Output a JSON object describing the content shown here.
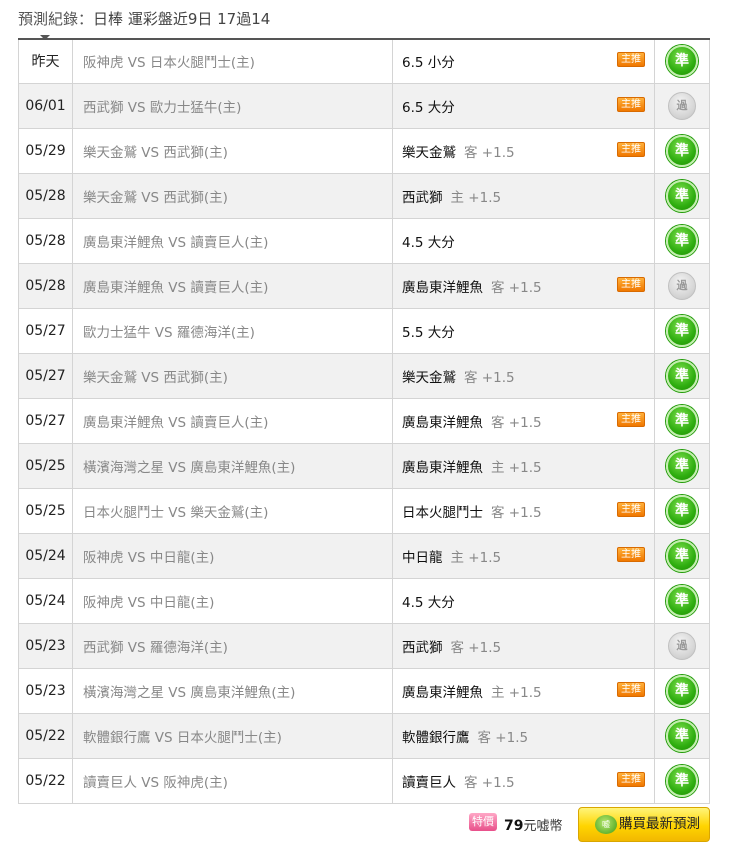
{
  "header": {
    "label": "預測紀錄：",
    "league": "日棒",
    "summary": "運彩盤近9日 17過14"
  },
  "tag_label": "主推",
  "result_labels": {
    "win": "準",
    "pass": "過"
  },
  "rows": [
    {
      "date": "昨天",
      "match": "阪神虎 VS 日本火腿鬥士(主)",
      "pick": "6.5 小分",
      "sub": "",
      "tag": true,
      "result": "win"
    },
    {
      "date": "06/01",
      "match": "西武獅 VS 歐力士猛牛(主)",
      "pick": "6.5 大分",
      "sub": "",
      "tag": true,
      "result": "pass"
    },
    {
      "date": "05/29",
      "match": "樂天金鷲 VS 西武獅(主)",
      "pick": "樂天金鷲",
      "sub": "客 +1.5",
      "tag": true,
      "result": "win"
    },
    {
      "date": "05/28",
      "match": "樂天金鷲 VS 西武獅(主)",
      "pick": "西武獅",
      "sub": "主 +1.5",
      "tag": false,
      "result": "win"
    },
    {
      "date": "05/28",
      "match": "廣島東洋鯉魚 VS 讀賣巨人(主)",
      "pick": "4.5 大分",
      "sub": "",
      "tag": false,
      "result": "win"
    },
    {
      "date": "05/28",
      "match": "廣島東洋鯉魚 VS 讀賣巨人(主)",
      "pick": "廣島東洋鯉魚",
      "sub": "客 +1.5",
      "tag": true,
      "result": "pass"
    },
    {
      "date": "05/27",
      "match": "歐力士猛牛 VS 羅德海洋(主)",
      "pick": "5.5 大分",
      "sub": "",
      "tag": false,
      "result": "win"
    },
    {
      "date": "05/27",
      "match": "樂天金鷲 VS 西武獅(主)",
      "pick": "樂天金鷲",
      "sub": "客 +1.5",
      "tag": false,
      "result": "win"
    },
    {
      "date": "05/27",
      "match": "廣島東洋鯉魚 VS 讀賣巨人(主)",
      "pick": "廣島東洋鯉魚",
      "sub": "客 +1.5",
      "tag": true,
      "result": "win"
    },
    {
      "date": "05/25",
      "match": "橫濱海灣之星 VS 廣島東洋鯉魚(主)",
      "pick": "廣島東洋鯉魚",
      "sub": "主 +1.5",
      "tag": false,
      "result": "win"
    },
    {
      "date": "05/25",
      "match": "日本火腿鬥士 VS 樂天金鷲(主)",
      "pick": "日本火腿鬥士",
      "sub": "客 +1.5",
      "tag": true,
      "result": "win"
    },
    {
      "date": "05/24",
      "match": "阪神虎 VS 中日龍(主)",
      "pick": "中日龍",
      "sub": "主 +1.5",
      "tag": true,
      "result": "win"
    },
    {
      "date": "05/24",
      "match": "阪神虎 VS 中日龍(主)",
      "pick": "4.5 大分",
      "sub": "",
      "tag": false,
      "result": "win"
    },
    {
      "date": "05/23",
      "match": "西武獅 VS 羅德海洋(主)",
      "pick": "西武獅",
      "sub": "客 +1.5",
      "tag": false,
      "result": "pass"
    },
    {
      "date": "05/23",
      "match": "橫濱海灣之星 VS 廣島東洋鯉魚(主)",
      "pick": "廣島東洋鯉魚",
      "sub": "主 +1.5",
      "tag": true,
      "result": "win"
    },
    {
      "date": "05/22",
      "match": "軟體銀行鷹 VS 日本火腿鬥士(主)",
      "pick": "軟體銀行鷹",
      "sub": "客 +1.5",
      "tag": false,
      "result": "win"
    },
    {
      "date": "05/22",
      "match": "讀賣巨人 VS 阪神虎(主)",
      "pick": "讀賣巨人",
      "sub": "客 +1.5",
      "tag": true,
      "result": "win"
    }
  ],
  "footer": {
    "special_label": "特價",
    "price": "79",
    "price_unit": "元嘘幣",
    "buy_label": "購買最新預測",
    "buy_icon_text": "嘘"
  },
  "colors": {
    "win_green": "#2fae10",
    "pass_gray": "#d2d2d2",
    "tag_orange": "#f07800",
    "buy_yellow": "#ffd400",
    "special_pink": "#e8508a"
  }
}
